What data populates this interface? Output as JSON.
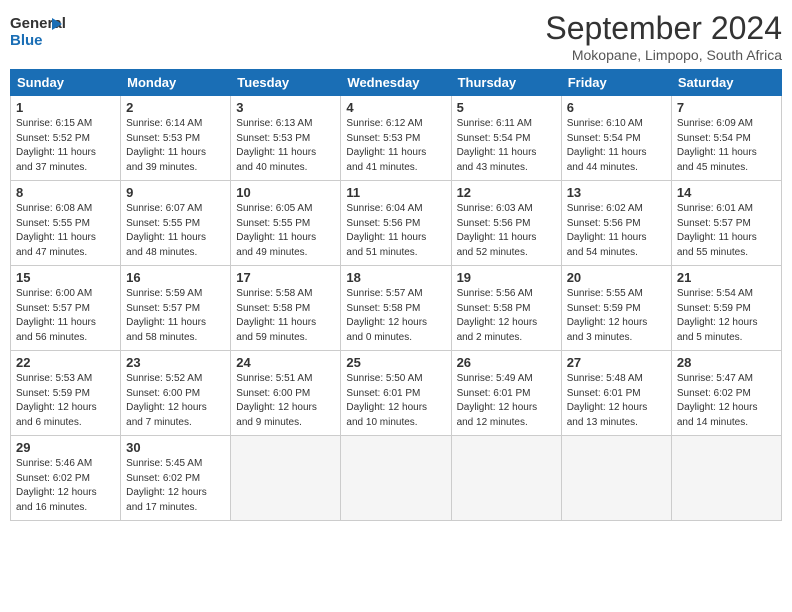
{
  "logo": {
    "line1": "General",
    "line2": "Blue"
  },
  "title": "September 2024",
  "location": "Mokopane, Limpopo, South Africa",
  "days_of_week": [
    "Sunday",
    "Monday",
    "Tuesday",
    "Wednesday",
    "Thursday",
    "Friday",
    "Saturday"
  ],
  "weeks": [
    [
      {
        "day": 1,
        "info": "Sunrise: 6:15 AM\nSunset: 5:52 PM\nDaylight: 11 hours\nand 37 minutes."
      },
      {
        "day": 2,
        "info": "Sunrise: 6:14 AM\nSunset: 5:53 PM\nDaylight: 11 hours\nand 39 minutes."
      },
      {
        "day": 3,
        "info": "Sunrise: 6:13 AM\nSunset: 5:53 PM\nDaylight: 11 hours\nand 40 minutes."
      },
      {
        "day": 4,
        "info": "Sunrise: 6:12 AM\nSunset: 5:53 PM\nDaylight: 11 hours\nand 41 minutes."
      },
      {
        "day": 5,
        "info": "Sunrise: 6:11 AM\nSunset: 5:54 PM\nDaylight: 11 hours\nand 43 minutes."
      },
      {
        "day": 6,
        "info": "Sunrise: 6:10 AM\nSunset: 5:54 PM\nDaylight: 11 hours\nand 44 minutes."
      },
      {
        "day": 7,
        "info": "Sunrise: 6:09 AM\nSunset: 5:54 PM\nDaylight: 11 hours\nand 45 minutes."
      }
    ],
    [
      {
        "day": 8,
        "info": "Sunrise: 6:08 AM\nSunset: 5:55 PM\nDaylight: 11 hours\nand 47 minutes."
      },
      {
        "day": 9,
        "info": "Sunrise: 6:07 AM\nSunset: 5:55 PM\nDaylight: 11 hours\nand 48 minutes."
      },
      {
        "day": 10,
        "info": "Sunrise: 6:05 AM\nSunset: 5:55 PM\nDaylight: 11 hours\nand 49 minutes."
      },
      {
        "day": 11,
        "info": "Sunrise: 6:04 AM\nSunset: 5:56 PM\nDaylight: 11 hours\nand 51 minutes."
      },
      {
        "day": 12,
        "info": "Sunrise: 6:03 AM\nSunset: 5:56 PM\nDaylight: 11 hours\nand 52 minutes."
      },
      {
        "day": 13,
        "info": "Sunrise: 6:02 AM\nSunset: 5:56 PM\nDaylight: 11 hours\nand 54 minutes."
      },
      {
        "day": 14,
        "info": "Sunrise: 6:01 AM\nSunset: 5:57 PM\nDaylight: 11 hours\nand 55 minutes."
      }
    ],
    [
      {
        "day": 15,
        "info": "Sunrise: 6:00 AM\nSunset: 5:57 PM\nDaylight: 11 hours\nand 56 minutes."
      },
      {
        "day": 16,
        "info": "Sunrise: 5:59 AM\nSunset: 5:57 PM\nDaylight: 11 hours\nand 58 minutes."
      },
      {
        "day": 17,
        "info": "Sunrise: 5:58 AM\nSunset: 5:58 PM\nDaylight: 11 hours\nand 59 minutes."
      },
      {
        "day": 18,
        "info": "Sunrise: 5:57 AM\nSunset: 5:58 PM\nDaylight: 12 hours\nand 0 minutes."
      },
      {
        "day": 19,
        "info": "Sunrise: 5:56 AM\nSunset: 5:58 PM\nDaylight: 12 hours\nand 2 minutes."
      },
      {
        "day": 20,
        "info": "Sunrise: 5:55 AM\nSunset: 5:59 PM\nDaylight: 12 hours\nand 3 minutes."
      },
      {
        "day": 21,
        "info": "Sunrise: 5:54 AM\nSunset: 5:59 PM\nDaylight: 12 hours\nand 5 minutes."
      }
    ],
    [
      {
        "day": 22,
        "info": "Sunrise: 5:53 AM\nSunset: 5:59 PM\nDaylight: 12 hours\nand 6 minutes."
      },
      {
        "day": 23,
        "info": "Sunrise: 5:52 AM\nSunset: 6:00 PM\nDaylight: 12 hours\nand 7 minutes."
      },
      {
        "day": 24,
        "info": "Sunrise: 5:51 AM\nSunset: 6:00 PM\nDaylight: 12 hours\nand 9 minutes."
      },
      {
        "day": 25,
        "info": "Sunrise: 5:50 AM\nSunset: 6:01 PM\nDaylight: 12 hours\nand 10 minutes."
      },
      {
        "day": 26,
        "info": "Sunrise: 5:49 AM\nSunset: 6:01 PM\nDaylight: 12 hours\nand 12 minutes."
      },
      {
        "day": 27,
        "info": "Sunrise: 5:48 AM\nSunset: 6:01 PM\nDaylight: 12 hours\nand 13 minutes."
      },
      {
        "day": 28,
        "info": "Sunrise: 5:47 AM\nSunset: 6:02 PM\nDaylight: 12 hours\nand 14 minutes."
      }
    ],
    [
      {
        "day": 29,
        "info": "Sunrise: 5:46 AM\nSunset: 6:02 PM\nDaylight: 12 hours\nand 16 minutes."
      },
      {
        "day": 30,
        "info": "Sunrise: 5:45 AM\nSunset: 6:02 PM\nDaylight: 12 hours\nand 17 minutes."
      },
      null,
      null,
      null,
      null,
      null
    ]
  ]
}
